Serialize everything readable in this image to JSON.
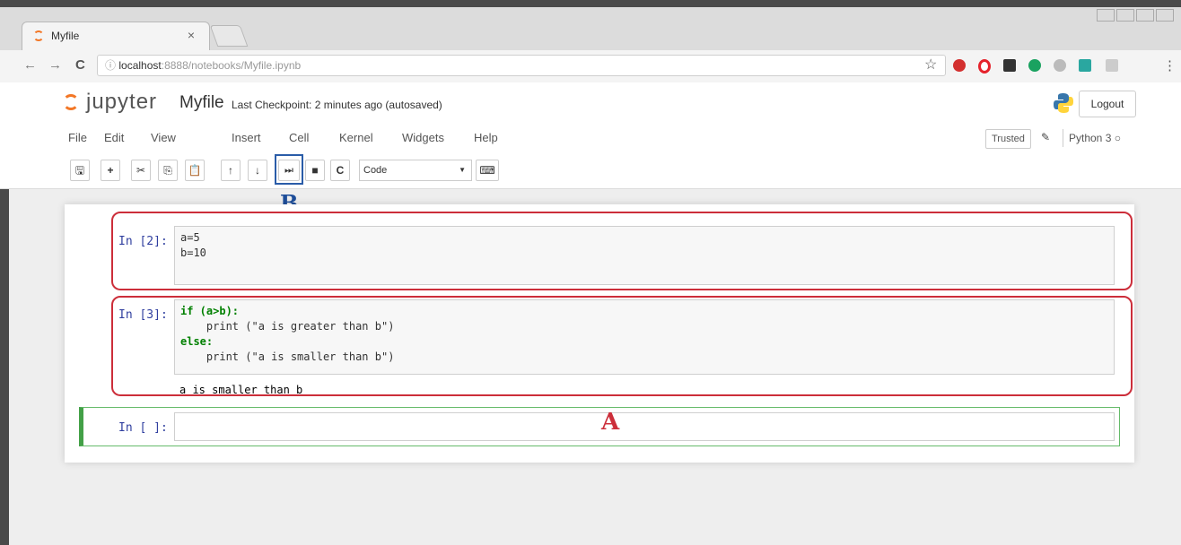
{
  "browser": {
    "tab_title": "Myfile",
    "tab_close": "×",
    "url_host": "localhost",
    "url_path": ":8888/notebooks/Myfile.ipynb",
    "back_icon": "←",
    "forward_icon": "→",
    "reload_icon": "C",
    "info_icon": "ⓘ",
    "star_icon": "☆",
    "menu_icon": "⋮"
  },
  "jupyter": {
    "logo_text": "jupyter",
    "notebook_name": "Myfile",
    "checkpoint": "Last Checkpoint: 2 minutes ago (autosaved)",
    "logout_label": "Logout",
    "trusted_label": "Trusted",
    "kernel_label": "Python 3",
    "menu": [
      "File",
      "Edit",
      "View",
      "Insert",
      "Cell",
      "Kernel",
      "Widgets",
      "Help"
    ],
    "cell_type": "Code"
  },
  "toolbar": {
    "save_icon": "🖫",
    "add_icon": "+",
    "cut_icon": "✂",
    "copy_icon": "⎘",
    "paste_icon": "📋",
    "up_icon": "↑",
    "down_icon": "↓",
    "run_icon": "⏭",
    "stop_icon": "■",
    "restart_icon": "C",
    "keyboard_icon": "⌨"
  },
  "annotations": {
    "label_b": "B",
    "label_a": "A"
  },
  "cells": [
    {
      "prompt": "In [2]:",
      "code": [
        "a=5",
        "b=10"
      ]
    },
    {
      "prompt": "In [3]:",
      "code": [
        "if (a>b):",
        "    print (\"a is greater than b\")",
        "else:",
        "    print (\"a is smaller than b\")"
      ],
      "output": "a is smaller than b"
    },
    {
      "prompt": "In [ ]:"
    }
  ]
}
